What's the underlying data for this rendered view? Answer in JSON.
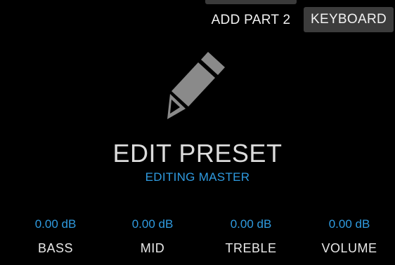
{
  "header": {
    "add_part_label": "ADD PART 2",
    "keyboard_label": "KEYBOARD"
  },
  "main": {
    "icon": "pencil-icon",
    "title": "EDIT PRESET",
    "subtitle": "EDITING MASTER"
  },
  "eq": [
    {
      "value": "0.00 dB",
      "label": "BASS"
    },
    {
      "value": "0.00 dB",
      "label": "MID"
    },
    {
      "value": "0.00 dB",
      "label": "TREBLE"
    },
    {
      "value": "0.00 dB",
      "label": "VOLUME"
    }
  ],
  "colors": {
    "background": "#000000",
    "accent": "#2f9be0",
    "button_bg": "#3c3c3c",
    "icon": "#8a8a8a"
  }
}
